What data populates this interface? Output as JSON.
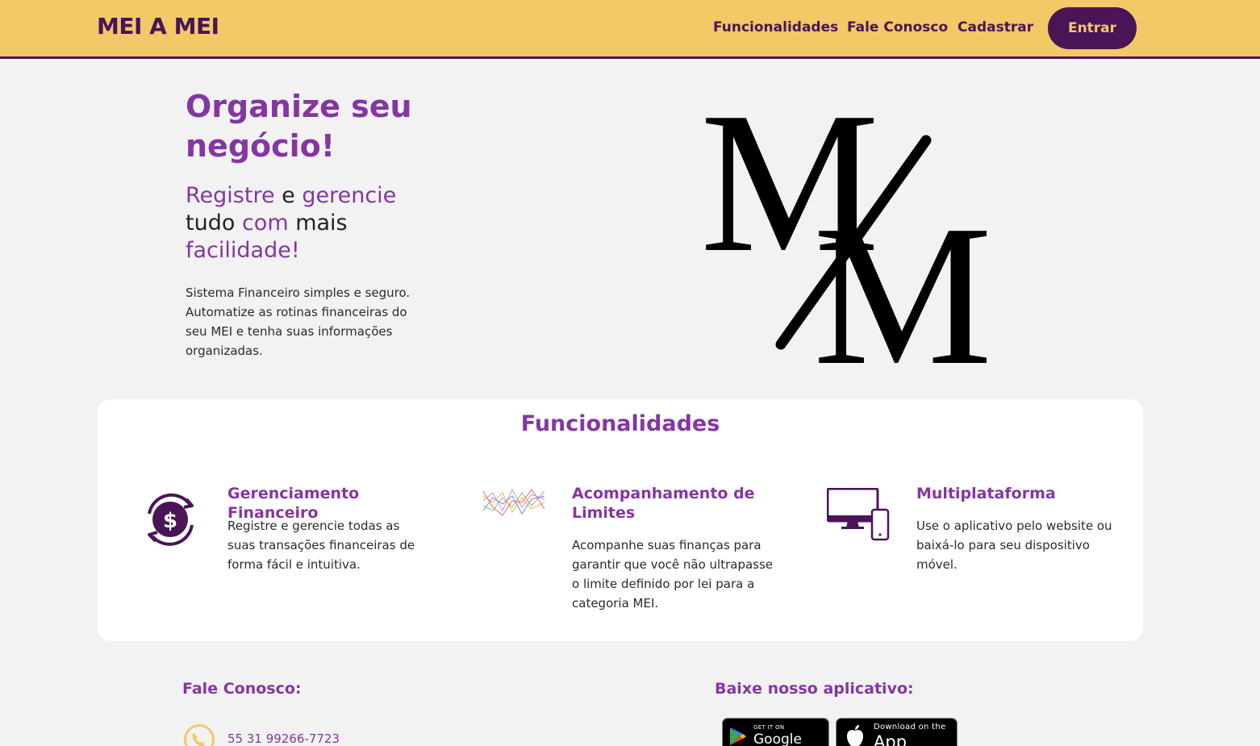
{
  "header": {
    "brand": "MEI A MEI",
    "nav": [
      {
        "label": "Funcionalidades"
      },
      {
        "label": "Fale Conosco"
      },
      {
        "label": "Cadastrar"
      }
    ],
    "login_label": "Entrar"
  },
  "hero": {
    "title": "Organize seu negócio!",
    "subtitle_parts": [
      "Registre",
      " e ",
      "gerencie",
      " tudo ",
      "com",
      " mais ",
      "facilidade!"
    ],
    "description": "Sistema Financeiro simples e seguro. Automatize as rotinas financeiras do seu MEI e tenha suas informações organizadas.",
    "logo_letters": [
      "M",
      "M"
    ]
  },
  "features": {
    "title": "Funcionalidades",
    "items": [
      {
        "icon": "money-cycle-icon",
        "title": "Gerenciamento Financeiro",
        "description": "Registre e gerencie todas as suas transações financeiras de forma fácil e intuitiva."
      },
      {
        "icon": "line-chart-icon",
        "title": "Acompanhamento de Limites",
        "description": "Acompanhe suas finanças para garantir que você não ultrapasse o limite definido por lei para a categoria MEI."
      },
      {
        "icon": "devices-icon",
        "title": "Multiplataforma",
        "description": "Use o aplicativo pelo website ou baixá-lo para seu dispositivo móvel."
      }
    ]
  },
  "footer": {
    "contact_title": "Fale Conosco:",
    "phone": "55 31 99266-7723",
    "app_title": "Baixe nosso aplicativo:",
    "google_play": {
      "small": "GET IT ON",
      "big": "Google Play"
    },
    "app_store": {
      "small": "Download on the",
      "big": "App Store"
    }
  },
  "colors": {
    "accent": "#8436a3",
    "dark_purple": "#4a1457",
    "header_yellow": "#f2c966",
    "background": "#f2f2f2"
  }
}
